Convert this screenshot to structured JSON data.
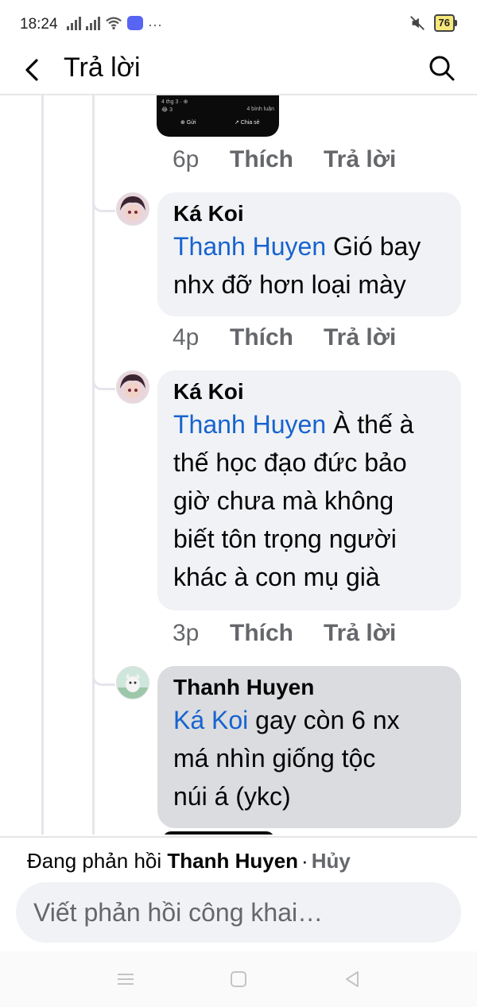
{
  "status_bar": {
    "time": "18:24",
    "battery": "76",
    "icons": [
      "signal-icon",
      "signal-icon",
      "wifi-icon",
      "discord-icon",
      "more-icon",
      "mute-icon",
      "battery-icon"
    ]
  },
  "header": {
    "title": "Trả lời",
    "back_icon": "chevron-left-icon",
    "search_icon": "search-icon"
  },
  "thread": {
    "preview_card": {
      "line1": "4 thg 3 · ⊕",
      "line2": "😂 3",
      "line3": "4 bình luận",
      "line4": "⊕ Gửi",
      "line5": "↗ Chia sẻ"
    },
    "preview_actions": {
      "time": "6p",
      "like": "Thích",
      "reply": "Trả lời"
    },
    "comments": [
      {
        "author": "Ká Koi",
        "mention": "Thanh Huyen",
        "lines": [
          "Gió bay",
          "nhx đỡ hơn loại mày"
        ],
        "time": "4p",
        "like": "Thích",
        "reply": "Trả lời"
      },
      {
        "author": "Ká Koi",
        "mention": "Thanh Huyen",
        "lines": [
          "À thế à",
          "thế học đạo đức bảo",
          "giờ chưa mà không",
          "biết tôn trọng người",
          "khác à con mụ già"
        ],
        "time": "3p",
        "like": "Thích",
        "reply": "Trả lời"
      },
      {
        "author": "Thanh Huyen",
        "mention": "Ká Koi",
        "lines": [
          "gay còn 6 nx",
          "má nhìn giống tộc",
          "núi á (ykc)"
        ]
      }
    ]
  },
  "composer": {
    "replying_prefix": "Đang phản hồi",
    "replying_to": "Thanh Huyen",
    "separator": "·",
    "cancel": "Hủy",
    "placeholder": "Viết phản hồi công khai…"
  },
  "navbar": {
    "icons": [
      "menu-icon",
      "home-icon",
      "back-icon"
    ]
  },
  "colors": {
    "mention": "#1763cf",
    "bubble": "#f0f2f5",
    "bubble_active": "#dadce0",
    "meta": "#65676b"
  }
}
